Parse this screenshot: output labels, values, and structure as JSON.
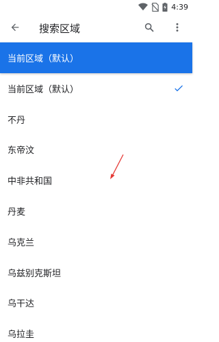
{
  "status_bar": {
    "time": "4:39",
    "icons": [
      "wifi-icon",
      "no-sim-icon",
      "battery-icon"
    ]
  },
  "app_bar": {
    "title": "搜索区域",
    "back_icon": "arrow-back-icon",
    "search_icon": "search-icon",
    "menu_icon": "more-vert-icon"
  },
  "selected_region": "当前区域（默认）",
  "regions": [
    {
      "label": "当前区域（默认）",
      "checked": true
    },
    {
      "label": "不丹",
      "checked": false
    },
    {
      "label": "东帝汶",
      "checked": false
    },
    {
      "label": "中非共和国",
      "checked": false
    },
    {
      "label": "丹麦",
      "checked": false
    },
    {
      "label": "乌克兰",
      "checked": false
    },
    {
      "label": "乌兹别克斯坦",
      "checked": false
    },
    {
      "label": "乌干达",
      "checked": false
    },
    {
      "label": "乌拉圭",
      "checked": false
    }
  ],
  "colors": {
    "accent": "#1a73e8",
    "annotation_arrow": "#e53935"
  }
}
